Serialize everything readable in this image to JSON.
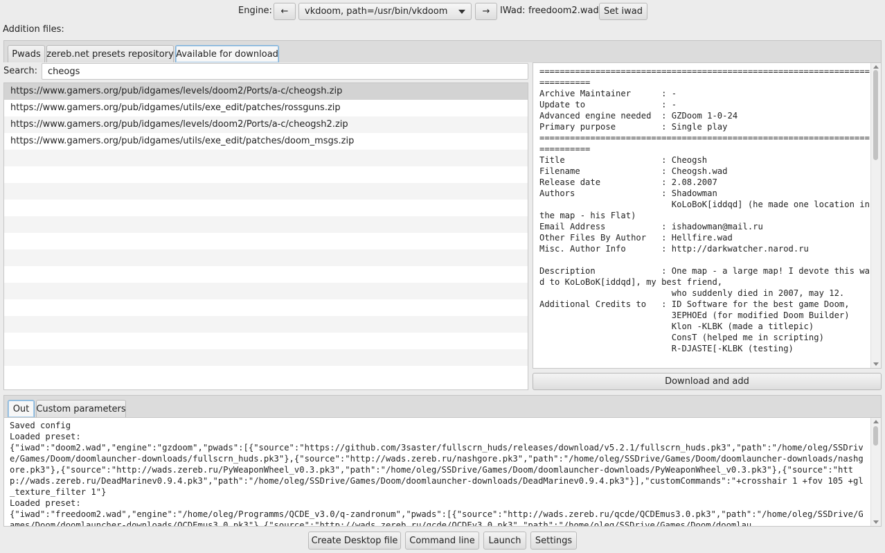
{
  "topbar": {
    "engine_label": "Engine:",
    "prev_label": "←",
    "engine_value": "vkdoom, path=/usr/bin/vkdoom",
    "next_label": "→",
    "iwad_label": "IWad:",
    "iwad_value": "freedoom2.wad",
    "set_iwad_label": "Set iwad"
  },
  "addition_files_label": "Addition files:",
  "tabs": [
    {
      "label": "Pwads"
    },
    {
      "label": "zereb.net presets repository"
    },
    {
      "label": "Available for download",
      "active": true
    }
  ],
  "search": {
    "label": "Search:",
    "value": "cheogs"
  },
  "results": [
    {
      "url": "https://www.gamers.org/pub/idgames/levels/doom2/Ports/a-c/cheogsh.zip",
      "selected": true
    },
    {
      "url": "https://www.gamers.org/pub/idgames/utils/exe_edit/patches/rossguns.zip"
    },
    {
      "url": "https://www.gamers.org/pub/idgames/levels/doom2/Ports/a-c/cheogsh2.zip"
    },
    {
      "url": "https://www.gamers.org/pub/idgames/utils/exe_edit/patches/doom_msgs.zip"
    }
  ],
  "description": "===========================================================================\nArchive Maintainer      : -\nUpdate to               : -\nAdvanced engine needed  : GZDoom 1-0-24\nPrimary purpose         : Single play\n===========================================================================\nTitle                   : Cheogsh\nFilename                : Cheogsh.wad\nRelease date            : 2.08.2007\nAuthors                 : Shadowman\n                          KoLoBoK[iddqd] (he made one location in the map - his Flat)\nEmail Address           : ishadowman@mail.ru\nOther Files By Author   : Hellfire.wad\nMisc. Author Info       : http://darkwatcher.narod.ru\n\nDescription             : One map - a large map! I devote this wad to KoLoBoK[iddqd], my best friend,\n                          who suddenly died in 2007, may 12.\nAdditional Credits to   : ID Software for the best game Doom,\n                          3EPHOEd (for modified Doom Builder)\n                          Klon -KLBK (made a titlepic)\n                          ConsT (helped me in scripting)\n                          R-DJASTE[-KLBK (testing)",
  "download_label": "Download and add",
  "bottom_tabs": [
    {
      "label": "Out",
      "active": true
    },
    {
      "label": "Custom parameters"
    }
  ],
  "log": "Saved config\nLoaded preset:\n{\"iwad\":\"doom2.wad\",\"engine\":\"gzdoom\",\"pwads\":[{\"source\":\"https://github.com/3saster/fullscrn_huds/releases/download/v5.2.1/fullscrn_huds.pk3\",\"path\":\"/home/oleg/SSDrive/Games/Doom/doomlauncher-downloads/fullscrn_huds.pk3\"},{\"source\":\"http://wads.zereb.ru/nashgore.pk3\",\"path\":\"/home/oleg/SSDrive/Games/Doom/doomlauncher-downloads/nashgore.pk3\"},{\"source\":\"http://wads.zereb.ru/PyWeaponWheel_v0.3.pk3\",\"path\":\"/home/oleg/SSDrive/Games/Doom/doomlauncher-downloads/PyWeaponWheel_v0.3.pk3\"},{\"source\":\"http://wads.zereb.ru/DeadMarinev0.9.4.pk3\",\"path\":\"/home/oleg/SSDrive/Games/Doom/doomlauncher-downloads/DeadMarinev0.9.4.pk3\"}],\"customCommands\":\"+crosshair 1 +fov 105 +gl_texture_filter 1\"}\nLoaded preset:\n{\"iwad\":\"freedoom2.wad\",\"engine\":\"/home/oleg/Programms/QCDE_v3.0/q-zandronum\",\"pwads\":[{\"source\":\"http://wads.zereb.ru/qcde/QCDEmus3.0.pk3\",\"path\":\"/home/oleg/SSDrive/Games/Doom/doomlauncher-downloads/QCDEmus3.0.pk3\"},{\"source\":\"http://wads.zereb.ru/qcde/QCDEv3.0.pk3\",\"path\":\"/home/oleg/SSDrive/Games/Doom/doomlau",
  "bottom_buttons": {
    "create_desktop": "Create Desktop file",
    "command_line": "Command line",
    "launch": "Launch",
    "settings": "Settings"
  }
}
